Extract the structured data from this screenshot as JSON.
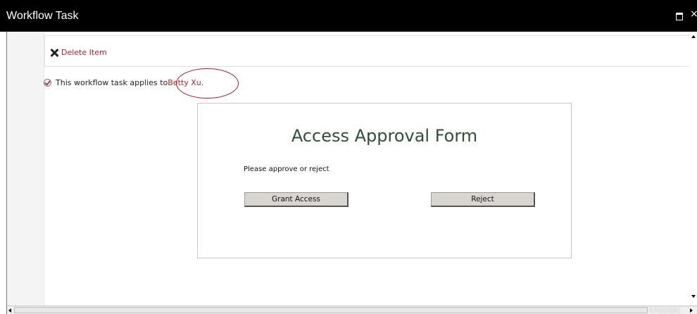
{
  "window": {
    "title": "Workflow Task",
    "maximize_icon": "maximize-icon",
    "close_icon": "close-icon",
    "close_glyph": "×"
  },
  "ribbon": {
    "delete_label": "Delete Item",
    "delete_icon": "x-delete-icon"
  },
  "task": {
    "applies_text": "This workflow task applies to ",
    "person": "Betty Xu",
    "suffix": ".",
    "icon": "task-check-icon"
  },
  "form": {
    "title": "Access Approval Form",
    "prompt": "Please approve or reject",
    "grant_label": "Grant Access",
    "reject_label": "Reject"
  },
  "colors": {
    "titlebar": "#000000",
    "link": "#b8212d",
    "highlight_circle": "#b31c2a",
    "form_title": "#2f4f3a",
    "button_face": "#d9d6d2"
  }
}
